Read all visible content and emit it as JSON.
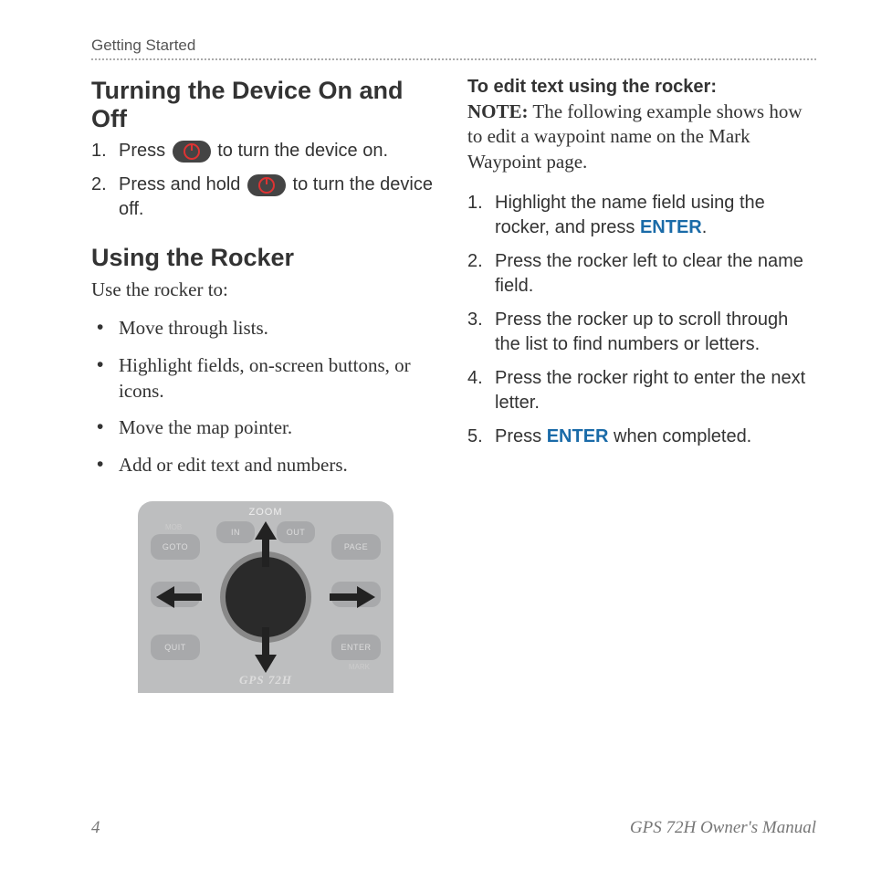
{
  "header": {
    "section": "Getting Started"
  },
  "left": {
    "h1": "Turning the Device On and Off",
    "steps_power": [
      {
        "pre": "Press ",
        "post": " to turn the device on."
      },
      {
        "pre": "Press and hold ",
        "post": " to turn the device off."
      }
    ],
    "h2": "Using the Rocker",
    "intro": "Use the rocker to:",
    "bullets": [
      "Move through lists.",
      "Highlight fields, on-screen buttons, or icons.",
      "Move the map pointer.",
      "Add or edit text and numbers."
    ]
  },
  "right": {
    "lead": "To edit text using the rocker:",
    "note_label": "NOTE:",
    "note_body": " The following example shows how to edit a waypoint name on the Mark Waypoint page.",
    "steps": [
      {
        "a": "Highlight the name field using the rocker, and press ",
        "key": "ENTER",
        "b": "."
      },
      {
        "a": "Press the rocker left to clear the name field."
      },
      {
        "a": "Press the rocker up to scroll through the list to find numbers or letters."
      },
      {
        "a": "Press the rocker right to enter the next letter."
      },
      {
        "a": "Press ",
        "key": "ENTER",
        "b": " when completed."
      }
    ]
  },
  "device": {
    "zoom": "ZOOM",
    "in": "IN",
    "out": "OUT",
    "mob": "MOB",
    "goto": "GOTO",
    "page": "PAGE",
    "quit": "QUIT",
    "enter": "ENTER",
    "mark": "MARK",
    "model": "GPS 72H"
  },
  "footer": {
    "page": "4",
    "title": "GPS 72H Owner's Manual"
  }
}
